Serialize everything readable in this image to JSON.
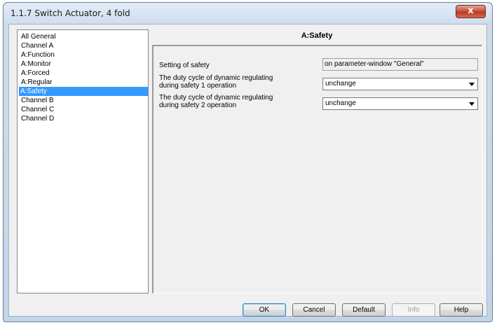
{
  "window": {
    "title": "1.1.7 Switch Actuator, 4 fold",
    "close_glyph": "x"
  },
  "tree": {
    "items": [
      {
        "label": "All General",
        "selected": false
      },
      {
        "label": "Channel A",
        "selected": false
      },
      {
        "label": "A:Function",
        "selected": false
      },
      {
        "label": "A:Monitor",
        "selected": false
      },
      {
        "label": "A:Forced",
        "selected": false
      },
      {
        "label": "A:Regular",
        "selected": false
      },
      {
        "label": "A:Safety",
        "selected": true
      },
      {
        "label": "Channel B",
        "selected": false
      },
      {
        "label": "Channel C",
        "selected": false
      },
      {
        "label": "Channel D",
        "selected": false
      }
    ]
  },
  "panel": {
    "heading": "A:Safety",
    "params": [
      {
        "label": "Setting of safety",
        "value": "on parameter-window \"General\""
      },
      {
        "label_line1": "The duty cycle of dynamic regulating",
        "label_line2": "during safety 1 operation",
        "value": "unchange"
      },
      {
        "label_line1": "The duty cycle of dynamic regulating",
        "label_line2": "during safety 2 operation",
        "value": "unchange"
      }
    ]
  },
  "buttons": {
    "ok": "OK",
    "cancel": "Cancel",
    "default_btn": "Default",
    "info": "Info",
    "help": "Help"
  },
  "colors": {
    "selection": "#3399ff",
    "close_button": "#c7553f"
  }
}
